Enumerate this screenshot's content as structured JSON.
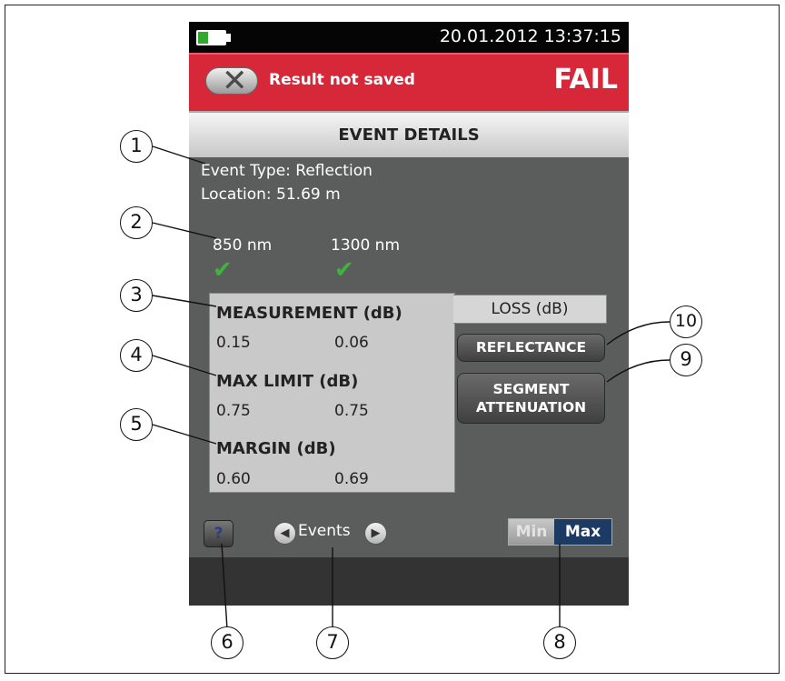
{
  "status_bar": {
    "datetime": "20.01.2012 13:37:15",
    "battery_icon": "battery-icon"
  },
  "result_bar": {
    "message": "Result not saved",
    "verdict": "FAIL",
    "close_icon": "close-icon",
    "color": "#d7283a"
  },
  "screen_title": "EVENT DETAILS",
  "event": {
    "type": "Event Type: Reflection",
    "location": "Location: 51.69 m"
  },
  "wavelengths": [
    {
      "label": "850 nm",
      "status": "pass",
      "icon": "checkmark-icon"
    },
    {
      "label": "1300 nm",
      "status": "pass",
      "icon": "checkmark-icon"
    }
  ],
  "loss_tab": "LOSS (dB)",
  "table": {
    "measurement": {
      "label": "MEASUREMENT (dB)",
      "values": [
        "0.15",
        "0.06"
      ]
    },
    "max_limit": {
      "label": "MAX LIMIT (dB)",
      "values": [
        "0.75",
        "0.75"
      ]
    },
    "margin": {
      "label": "MARGIN (dB)",
      "values": [
        "0.60",
        "0.69"
      ]
    }
  },
  "buttons": {
    "reflectance": "REFLECTANCE",
    "segment_attenuation_1": "SEGMENT",
    "segment_attenuation_2": "ATTENUATION",
    "help": "?",
    "events": "Events",
    "min": "Min",
    "max": "Max"
  },
  "callouts": [
    "1",
    "2",
    "3",
    "4",
    "5",
    "6",
    "7",
    "8",
    "9",
    "10"
  ],
  "colors": {
    "pass_green": "#3eb43a",
    "max_selected": "#1d3a63",
    "screen_bg": "#5b5d5c"
  }
}
